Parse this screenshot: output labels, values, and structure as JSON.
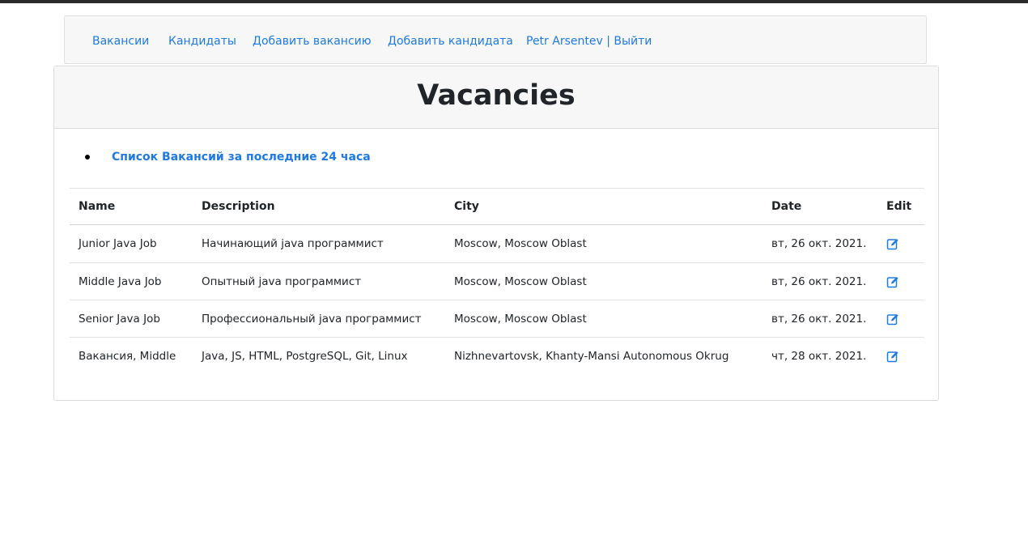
{
  "nav": {
    "items": [
      {
        "label": "Вакансии"
      },
      {
        "label": "Кандидаты"
      },
      {
        "label": "Добавить вакансию"
      },
      {
        "label": "Добавить кандидата"
      },
      {
        "label": "Petr Arsentev | Выйти"
      }
    ]
  },
  "card": {
    "title": "Vacancies",
    "recent_link": "Список Вакансий за последние 24 часа"
  },
  "table": {
    "headers": [
      "Name",
      "Description",
      "City",
      "Date",
      "Edit"
    ],
    "rows": [
      {
        "name": "Junior Java Job",
        "description": "Начинающий java программист",
        "city": "Moscow, Moscow Oblast",
        "date": "вт, 26 окт. 2021.",
        "edit_icon": "edit-icon"
      },
      {
        "name": "Middle Java Job",
        "description": "Опытный java программист",
        "city": "Moscow, Moscow Oblast",
        "date": "вт, 26 окт. 2021.",
        "edit_icon": "edit-icon"
      },
      {
        "name": "Senior Java Job",
        "description": "Профессиональный java программист",
        "city": "Moscow, Moscow Oblast",
        "date": "вт, 26 окт. 2021.",
        "edit_icon": "edit-icon"
      },
      {
        "name": "Вакансия, Middle",
        "description": "Java, JS, HTML, PostgreSQL, Git, Linux",
        "city": "Nizhnevartovsk, Khanty-Mansi Autonomous Okrug",
        "date": "чт, 28 окт. 2021.",
        "edit_icon": "edit-icon"
      }
    ]
  },
  "colors": {
    "link": "#1f7ae0",
    "text": "#212529",
    "header_bg": "#f7f7f7"
  }
}
